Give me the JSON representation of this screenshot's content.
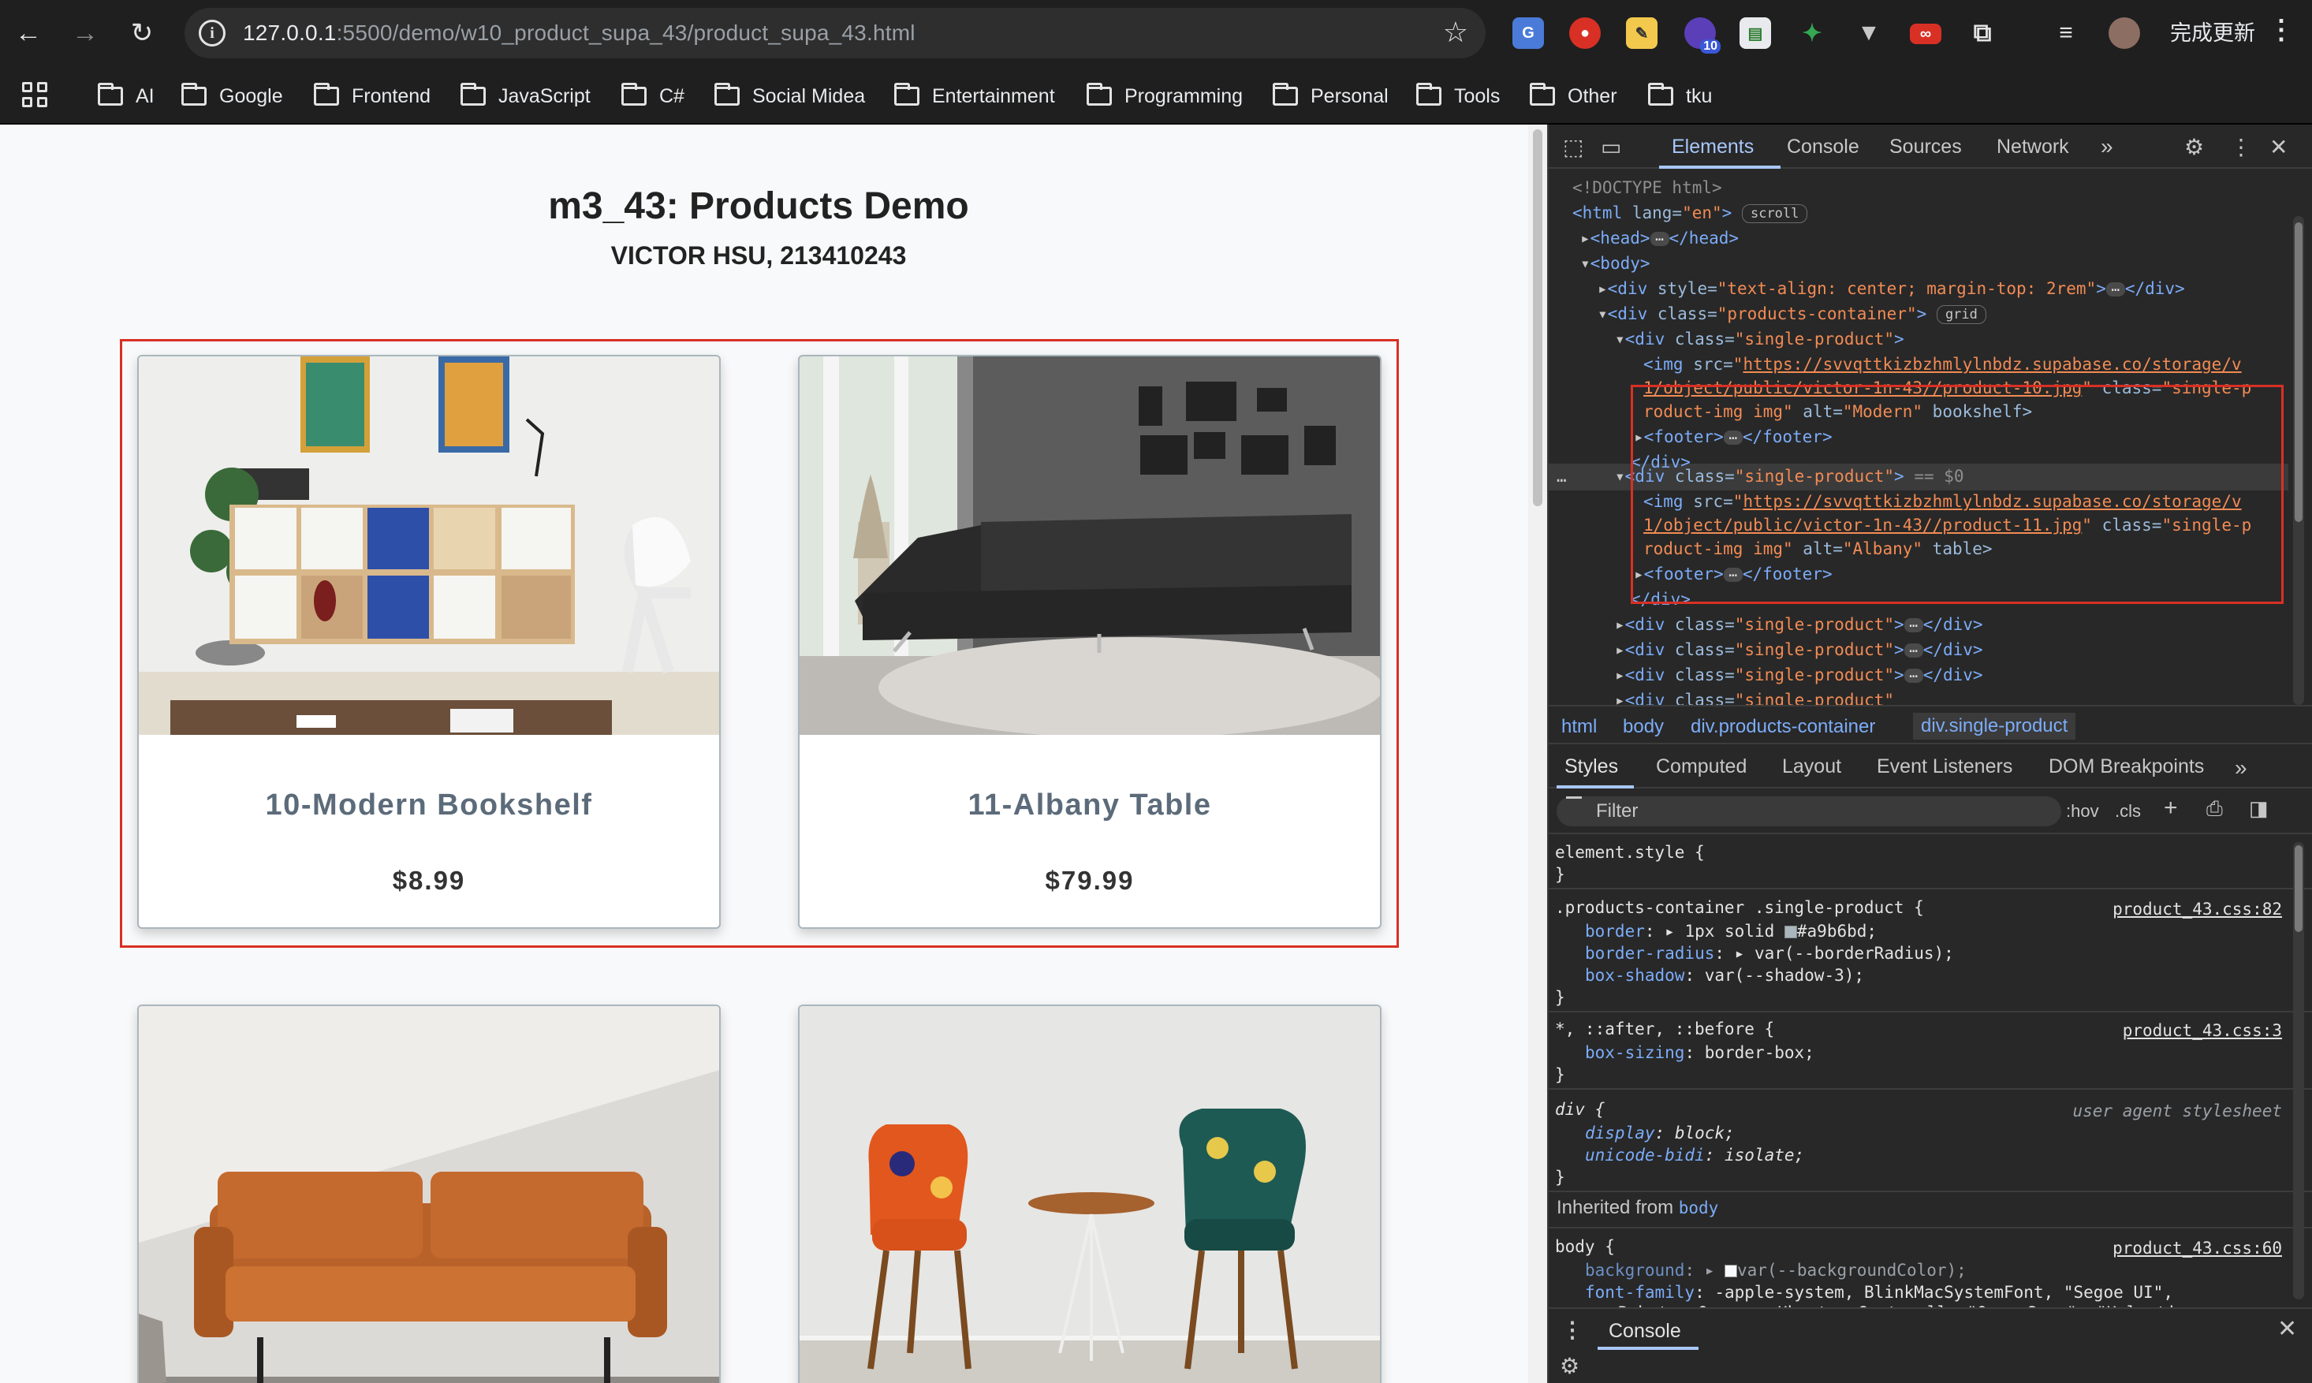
{
  "browser": {
    "url_host": "127.0.0.1",
    "url_path": ":5500/demo/w10_product_supa_43/product_supa_43.html",
    "update_label": "完成更新",
    "ext_badge": "10",
    "bookmarks": [
      "AI",
      "Google",
      "Frontend",
      "JavaScript",
      "C#",
      "Social Midea",
      "Entertainment",
      "Programming",
      "Personal",
      "Tools",
      "Other",
      "tku"
    ]
  },
  "page": {
    "title": "m3_43: Products Demo",
    "subtitle": "VICTOR HSU, 213410243",
    "products": [
      {
        "name": "10-Modern Bookshelf",
        "price": "$8.99"
      },
      {
        "name": "11-Albany Table",
        "price": "$79.99"
      },
      {
        "name": "",
        "price": ""
      },
      {
        "name": "",
        "price": ""
      }
    ]
  },
  "devtools": {
    "tabs": [
      "Elements",
      "Console",
      "Sources",
      "Network"
    ],
    "active_tab": "Elements",
    "breadcrumbs": [
      "html",
      "body",
      "div.products-container",
      "div.single-product"
    ],
    "styles_tabs": [
      "Styles",
      "Computed",
      "Layout",
      "Event Listeners",
      "DOM Breakpoints"
    ],
    "filter_placeholder": "Filter",
    "filter_buttons": [
      ":hov",
      ".cls"
    ],
    "console_tab": "Console",
    "dom": {
      "doctype": "<!DOCTYPE html>",
      "html_open": "<html",
      "html_lang_attr": " lang=",
      "html_lang_val": "\"en\"",
      "html_close": ">",
      "scroll_chip": "scroll",
      "grid_chip": "grid",
      "head_open": "<head>",
      "head_close": "</head>",
      "body_open": "<body>",
      "div_style_attr": " style=",
      "div_style_val": "\"text-align: center; margin-top: 2rem\"",
      "div_close": "</div>",
      "products_container_class": "\"products-container\"",
      "single_product_class": "\"single-product\"",
      "img_src_1a": "https://svvqttkizbzhmlylnbdz.supabase.co/storage/v",
      "img_src_1b": "1/object/public/victor-1n-43//product-10.jpg",
      "img_src_2b": "1/object/public/victor-1n-43//product-11.jpg",
      "img_class_a": "\"single-p",
      "img_class_b": "roduct-img img\"",
      "img_alt_1": "\"Modern\"",
      "img_alt_1_extra": " bookshelf>",
      "img_alt_2": "\"Albany\"",
      "img_alt_2_extra": " table>",
      "footer_open": "<footer>",
      "footer_close": "</footer>",
      "selected_marker": " == $0",
      "div_open": "<div",
      "class_attr": " class=",
      "img_open": "<img",
      "src_attr": " src=",
      "alt_attr": " alt=",
      "gt": ">"
    },
    "rules": {
      "element_style": "element.style {",
      "close_brace": "}",
      "rule1_selector": ".products-container .single-product {",
      "rule1_source": "product_43.css:82",
      "border_prop": "border",
      "border_val_a": "1px solid",
      "border_val_b": "#a9b6bd;",
      "radius_prop": "border-radius",
      "radius_val": "var(--borderRadius);",
      "shadow_prop": "box-shadow",
      "shadow_val": "var(--shadow-3);",
      "rule2_selector": "*, ::after, ::before {",
      "rule2_source": "product_43.css:3",
      "sizing_prop": "box-sizing",
      "sizing_val": "border-box;",
      "rule3_selector": "div {",
      "rule3_source": "user agent stylesheet",
      "display_prop": "display",
      "display_val": "block;",
      "bidi_prop": "unicode-bidi",
      "bidi_val": "isolate;",
      "inherited_label": "Inherited from",
      "inherited_el": "body",
      "rule4_selector": "body {",
      "rule4_source": "product_43.css:60",
      "bg_prop": "background",
      "bg_val": "var(--backgroundColor);",
      "ff_prop": "font-family",
      "ff_val": "-apple-system, BlinkMacSystemFont, \"Segoe UI\",",
      "ff_val2": "Roboto, Oxygen, Ubuntu, Cantarell, \"Open Sans\", \"Helvetica"
    }
  },
  "colors": {
    "highlight": "#d93025",
    "card_border": "#a9b6bd",
    "devtools_bg": "#282828",
    "link_blue": "#7cacf8"
  }
}
